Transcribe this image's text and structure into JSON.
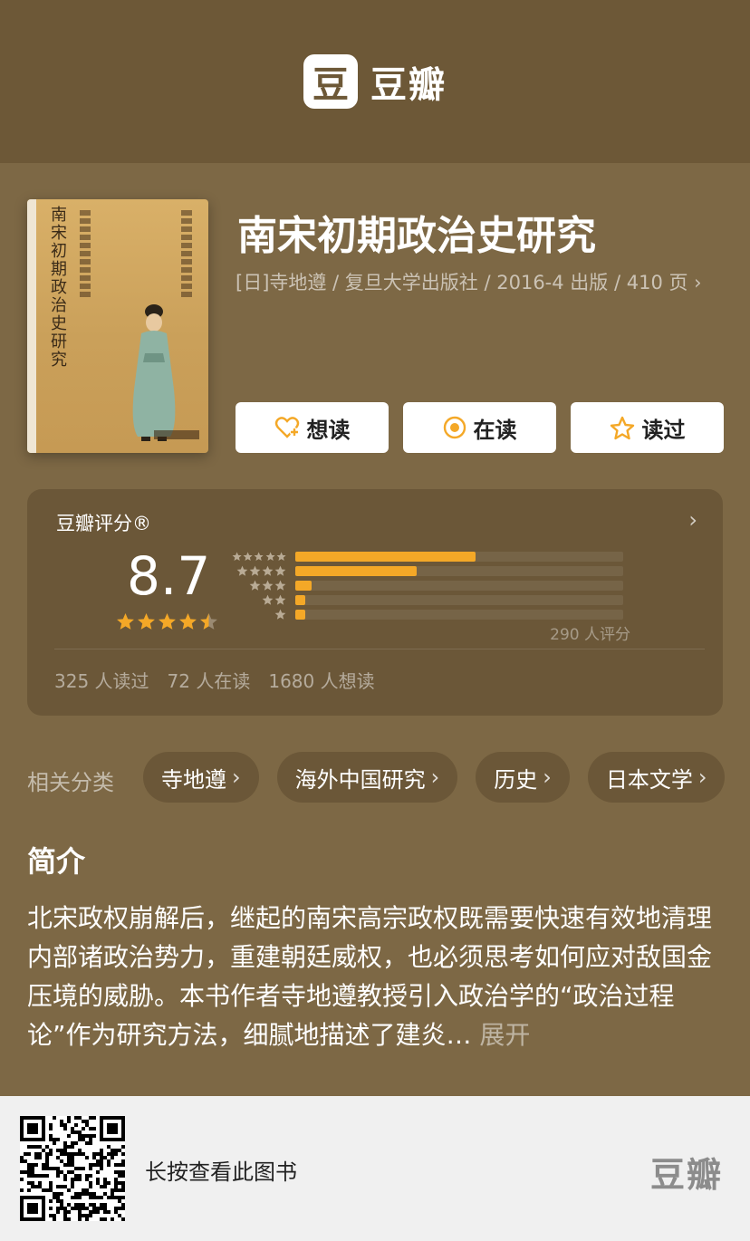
{
  "header": {
    "logo_glyph": "豆",
    "logo_text": "豆瓣"
  },
  "book": {
    "cover_title": "南宋初期政治史研究",
    "title": "南宋初期政治史研究",
    "meta": "[日]寺地遵 / 复旦大学出版社 / 2016-4 出版 / 410 页",
    "meta_chevron": "›"
  },
  "actions": [
    {
      "label": "想读",
      "icon": "heart-plus-icon"
    },
    {
      "label": "在读",
      "icon": "target-icon"
    },
    {
      "label": "读过",
      "icon": "star-outline-icon"
    }
  ],
  "rating": {
    "label": "豆瓣评分®",
    "score": "8.7",
    "stars": 4.5,
    "distribution": [
      {
        "stars": 5,
        "fraction": 0.55
      },
      {
        "stars": 4,
        "fraction": 0.37
      },
      {
        "stars": 3,
        "fraction": 0.05
      },
      {
        "stars": 2,
        "fraction": 0.03
      },
      {
        "stars": 1,
        "fraction": 0.03
      }
    ],
    "count": "290 人评分",
    "read": "325 人读过",
    "reading": "72 人在读",
    "want": "1680 人想读"
  },
  "tags": {
    "label": "相关分类",
    "items": [
      "寺地遵",
      "海外中国研究",
      "历史",
      "日本文学"
    ]
  },
  "intro": {
    "heading": "简介",
    "text": "北宋政权崩解后，继起的南宋高宗政权既需要快速有效地清理内部诸政治势力，重建朝廷威权，也必须思考如何应对敌国金压境的威胁。本书作者寺地遵教授引入政治学的“政治过程论”作为研究方法，细腻地描述了建炎… ",
    "more": "展开"
  },
  "footer": {
    "hint": "长按查看此图书",
    "logo": "豆瓣"
  },
  "colors": {
    "accent": "#f4a827",
    "background": "#7d6845",
    "header": "#6d5837",
    "card": "#6b5738"
  }
}
